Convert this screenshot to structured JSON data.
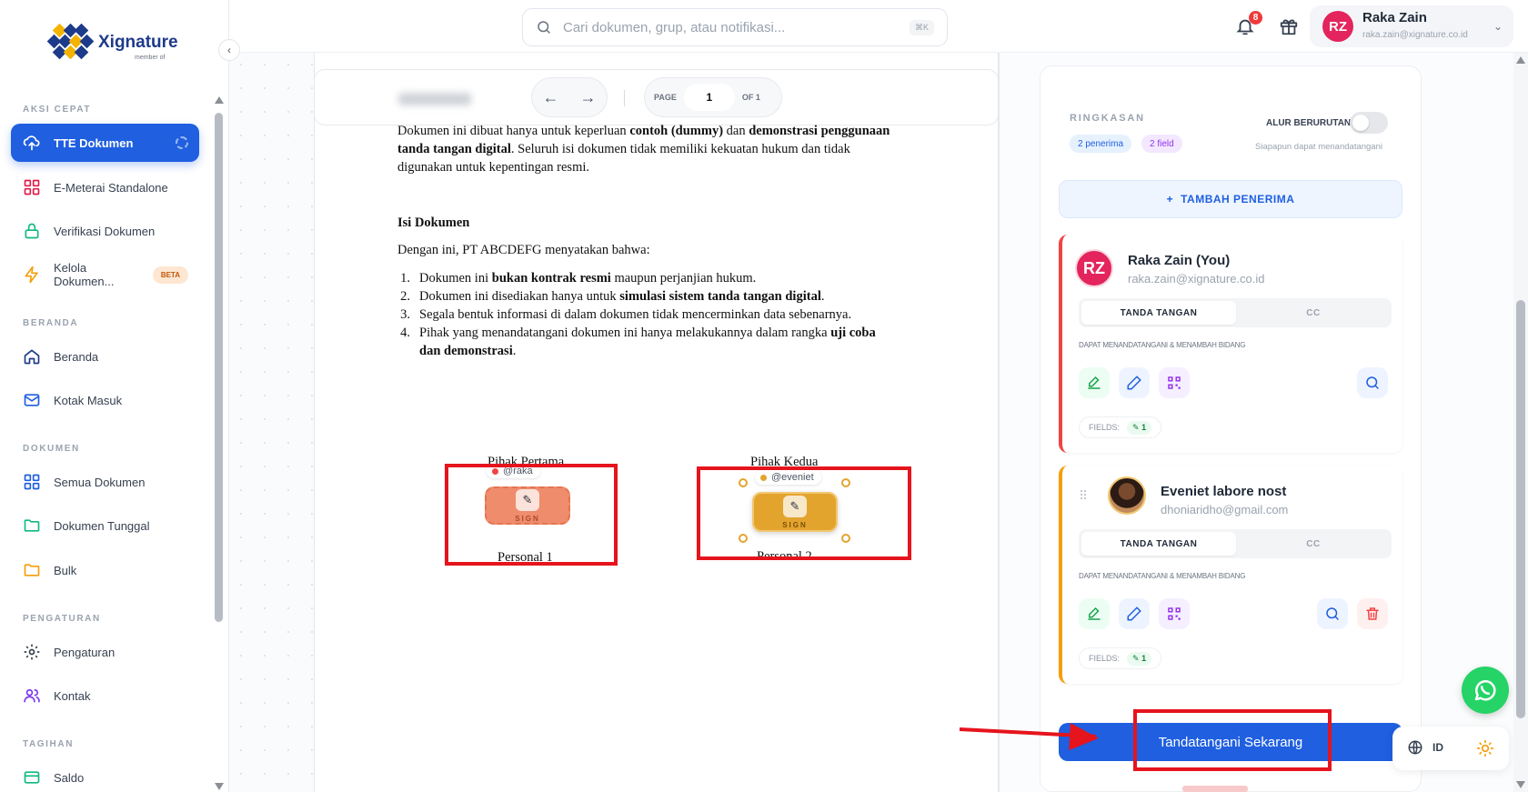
{
  "brand": {
    "name": "Xignature",
    "sub": "member of"
  },
  "sidebar": {
    "sections": [
      {
        "label": "AKSI CEPAT"
      },
      {
        "label": "BERANDA"
      },
      {
        "label": "DOKUMEN"
      },
      {
        "label": "PENGATURAN"
      },
      {
        "label": "TAGIHAN"
      }
    ],
    "items": [
      {
        "label": "TTE Dokumen",
        "icon": "cloud-upload-icon",
        "active": true
      },
      {
        "label": "E-Meterai Standalone",
        "icon": "grid-icon"
      },
      {
        "label": "Verifikasi Dokumen",
        "icon": "lock-icon"
      },
      {
        "label": "Kelola Dokumen...",
        "icon": "bolt-icon",
        "badge": "BETA"
      },
      {
        "label": "Beranda",
        "icon": "home-icon"
      },
      {
        "label": "Kotak Masuk",
        "icon": "mail-icon"
      },
      {
        "label": "Semua Dokumen",
        "icon": "grid-icon"
      },
      {
        "label": "Dokumen Tunggal",
        "icon": "folder-icon"
      },
      {
        "label": "Bulk",
        "icon": "folder-icon"
      },
      {
        "label": "Pengaturan",
        "icon": "gear-icon"
      },
      {
        "label": "Kontak",
        "icon": "users-icon"
      },
      {
        "label": "Saldo",
        "icon": "card-icon"
      }
    ]
  },
  "topbar": {
    "search_placeholder": "Cari dokumen, grup, atau notifikasi...",
    "shortcut": "⌘K",
    "notif_count": "8",
    "user": {
      "initials": "RZ",
      "name": "Raka Zain",
      "email": "raka.zain@xignature.co.id"
    }
  },
  "viewer": {
    "page_label": "PAGE",
    "page_value": "1",
    "of_label": "OF 1"
  },
  "document": {
    "intro_1": "Dokumen ini dibuat hanya untuk keperluan ",
    "intro_b1": "contoh (dummy)",
    "intro_2": " dan ",
    "intro_b2": "demonstrasi penggunaan",
    "intro_b3": "tanda tangan digital",
    "intro_3": ". Seluruh isi dokumen tidak memiliki kekuatan hukum dan tidak",
    "intro_4": "digunakan untuk kepentingan resmi.",
    "heading": "Isi Dokumen",
    "lead": "Dengan ini, PT ABCDEFG menyatakan bahwa:",
    "list": [
      {
        "n": "1.",
        "a": "Dokumen ini ",
        "b": "bukan kontrak resmi",
        "c": " maupun perjanjian hukum."
      },
      {
        "n": "2.",
        "a": "Dokumen ini disediakan hanya untuk ",
        "b": "simulasi sistem tanda tangan digital",
        "c": "."
      },
      {
        "n": "3.",
        "a": "Segala bentuk informasi di dalam dokumen tidak mencerminkan data sebenarnya.",
        "b": "",
        "c": ""
      },
      {
        "n": "4.",
        "a": "Pihak yang menandatangani dokumen ini hanya melakukannya dalam rangka ",
        "b": "uji coba",
        "c": ""
      }
    ],
    "list4_cont_b": "dan demonstrasi",
    "list4_cont_c": ".",
    "party1": {
      "title": "Pihak Pertama",
      "name": "Personal 1",
      "tag": "@raka",
      "sign": "SIGN"
    },
    "party2": {
      "title": "Pihak Kedua",
      "name": "Personal 2",
      "tag": "@eveniet",
      "sign": "SIGN"
    }
  },
  "panel": {
    "summary_label": "RINGKASAN",
    "recipients_pill": "2 penerima",
    "fields_pill": "2 field",
    "sequential_label": "ALUR BERURUTAN",
    "sequential_hint": "Siapapun dapat menandatangani",
    "add_recipient": "TAMBAH PENERIMA",
    "recipients": [
      {
        "initials": "RZ",
        "name": "Raka Zain (You)",
        "email": "raka.zain@xignature.co.id",
        "accent": "#ef4444",
        "tab_sign": "TANDA TANGAN",
        "tab_cc": "CC",
        "permission": "DAPAT MENANDATANGANI & MENAMBAH BIDANG",
        "fields_label": "FIELDS:",
        "fields_count": "1"
      },
      {
        "name": "Eveniet labore nost",
        "email": "dhoniaridho@gmail.com",
        "accent": "#f59e0b",
        "tab_sign": "TANDA TANGAN",
        "tab_cc": "CC",
        "permission": "DAPAT MENANDATANGANI & MENAMBAH BIDANG",
        "fields_label": "FIELDS:",
        "fields_count": "1"
      }
    ],
    "sign_now": "Tandatangani Sekarang",
    "lang": "ID"
  },
  "colors": {
    "primary": "#1f5fe0",
    "annotation": "#e5141d",
    "party1": "#ee8c6c",
    "party2": "#e3a42e"
  }
}
